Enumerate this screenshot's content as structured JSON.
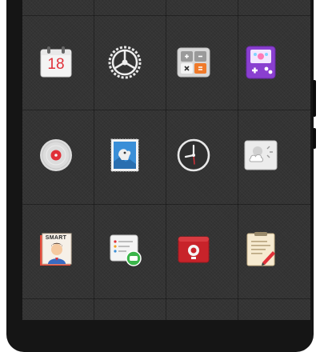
{
  "home_screen": {
    "apps": [
      {
        "id": "calendar",
        "icon": "calendar-icon",
        "date_text": "18"
      },
      {
        "id": "settings",
        "icon": "gear-icon"
      },
      {
        "id": "calculator",
        "icon": "calculator-icon"
      },
      {
        "id": "game",
        "icon": "game-console-icon"
      },
      {
        "id": "music",
        "icon": "music-disc-icon"
      },
      {
        "id": "gallery",
        "icon": "photo-stamp-icon"
      },
      {
        "id": "clock",
        "icon": "clock-icon"
      },
      {
        "id": "weather",
        "icon": "weather-icon"
      },
      {
        "id": "contacts",
        "icon": "contact-card-icon",
        "card_label": "SMART"
      },
      {
        "id": "messaging",
        "icon": "message-icon"
      },
      {
        "id": "recorder",
        "icon": "recorder-icon"
      },
      {
        "id": "notes",
        "icon": "notepad-icon"
      }
    ]
  },
  "colors": {
    "screen_background": "#343434",
    "calendar_red": "#e0313a",
    "calculator_orange": "#f07a2a",
    "game_purple": "#8a3fd0",
    "recorder_red": "#c8232a",
    "messaging_green": "#3bb54a"
  }
}
